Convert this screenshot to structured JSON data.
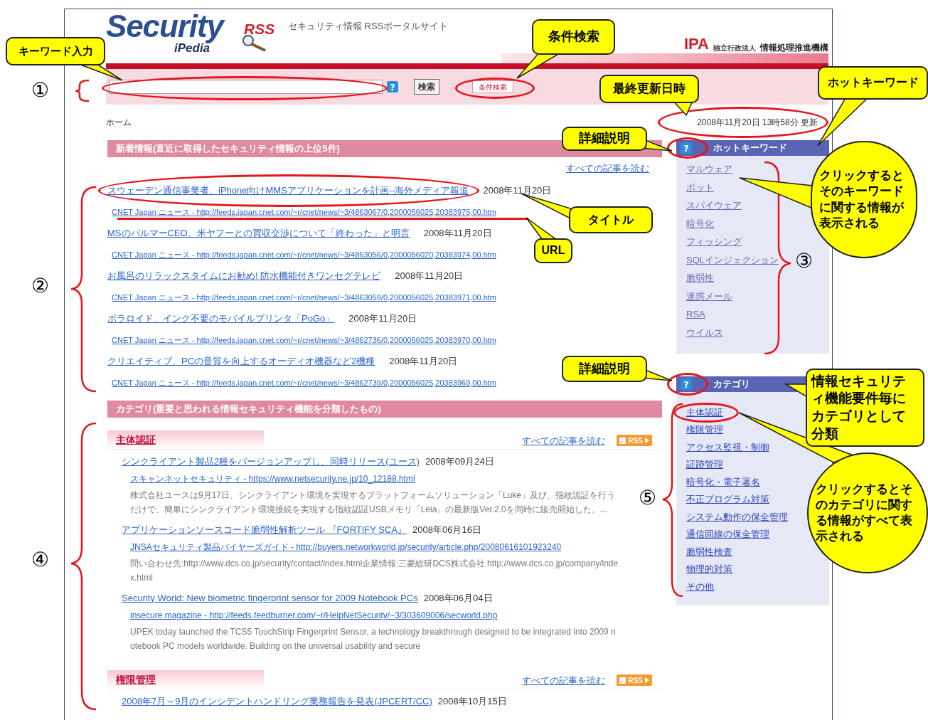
{
  "header": {
    "logo_main": "Security",
    "logo_rss": "RSS",
    "logo_sub": "iPedia",
    "tagline": "セキュリティ情報 RSSポータルサイト",
    "org_logo": "IPA",
    "org_type": "独立行政法人",
    "org_name": "情報処理推進機構"
  },
  "search": {
    "help_icon": "?",
    "search_button": "検索",
    "advanced_button": "条件検索"
  },
  "breadcrumb": "ホーム",
  "updated": "2008年11月20日 13時58分 更新",
  "latest": {
    "heading": "新着情報(直近に取得したセキュリティ情報の上位5件)",
    "read_all": "すべての記事を読む",
    "items": [
      {
        "title": "スウェーデン通信事業者、iPhone向けMMSアプリケーションを計画--海外メディア報道",
        "date": "2008年11月20日",
        "url": "CNET Japan ニュース - http://feeds.japan.cnet.com/~r/cnet/news/~3/4863067/0,2000056025,20383975,00.htm"
      },
      {
        "title": "MSのバルマーCEO、米ヤフーとの買収交渉について「終わった」と明言",
        "date": "2008年11月20日",
        "url": "CNET Japan ニュース - http://feeds.japan.cnet.com/~r/cnet/news/~3/4863056/0,2000056020,20383974,00.htm"
      },
      {
        "title": "お風呂のリラックスタイムにお勧め! 防水機能付きワンセグテレビ",
        "date": "2008年11月20日",
        "url": "CNET Japan ニュース - http://feeds.japan.cnet.com/~r/cnet/news/~3/4863059/0,2000056025,20383971,00.htm"
      },
      {
        "title": "ポラロイド、インク不要のモバイルプリンタ「PoGo」",
        "date": "2008年11月20日",
        "url": "CNET Japan ニュース - http://feeds.japan.cnet.com/~r/cnet/news/~3/4862736/0,2000056025,20383970,00.htm"
      },
      {
        "title": "クリエイティブ、PCの音質を向上するオーディオ機器など2機種",
        "date": "2008年11月20日",
        "url": "CNET Japan ニュース - http://feeds.japan.cnet.com/~r/cnet/news/~3/4862739/0,2000056025,20383969,00.htm"
      }
    ]
  },
  "categories": {
    "heading": "カテゴリ(重要と思われる情報セキュリティ機能を分類したもの)",
    "sections": [
      {
        "name": "主体認証",
        "read_all": "すべての記事を読む",
        "rss": "RSS",
        "items": [
          {
            "title": "シンクライアント製品2種をバージョンアップし、同時リリース(ユース)",
            "date": "2008年09月24日",
            "url": "スキャンネットセキュリティ - https://www.netsecurity.ne.jp/10_12188.html",
            "description": "株式会社ユースは9月17日、シンクライアント環境を実現するプラットフォームソリューション「Luke」及び、指紋認証を行うだけで、簡単にシンクライアント環境接続を実現する指紋認証USBメモリ「Leia」の最新版Ver.2.0を同時に販売開始した。..."
          },
          {
            "title": "アプリケーションソースコード脆弱性解析ツール 『FORTIFY SCA』",
            "date": "2008年06月16日",
            "url": "JNSAセキュリティ製品バイヤーズガイド - http://buyers.networkworld.jp/security/article.php/20080616101923240",
            "description": "問い合わせ先:http://www.dcs.co.jp/security/contact/index.html企業情報:三菱総研DCS株式会社 http://www.dcs.co.jp/company/index.html"
          },
          {
            "title": "Security World: New biometric fingerprint sensor for 2009 Notebook PCs",
            "date": "2008年06月04日",
            "url": "insecure magazine - http://feeds.feedburner.com/~r/HelpNetSecurity/~3/303609006/secworld.php",
            "description": "UPEK today launched the TCS5 TouchStrip Fingerprint Sensor, a technology breakthrough designed to be integrated into 2009 notebook PC models worldwide. Building on the universal usability and secure"
          }
        ]
      },
      {
        "name": "権限管理",
        "read_all": "すべての記事を読む",
        "rss": "RSS",
        "items": [
          {
            "title": "2008年7月～9月のインシデントハンドリング業務報告を発表(JPCERT/CC)",
            "date": "2008年10月15日"
          }
        ]
      }
    ]
  },
  "sidebar": {
    "hot_keywords": {
      "icon": "?",
      "heading": "ホットキーワード",
      "items": [
        "マルウェア",
        "ボット",
        "スパイウェア",
        "暗号化",
        "フィッシング",
        "SQLインジェクション",
        "脆弱性",
        "迷惑メール",
        "RSA",
        "ウイルス"
      ]
    },
    "categories": {
      "icon": "?",
      "heading": "カテゴリ",
      "items": [
        "主体認証",
        "権限管理",
        "アクセス監視・制御",
        "証跡管理",
        "暗号化・電子署名",
        "不正プログラム対策",
        "システム動作の保全管理",
        "通信回線の保全管理",
        "脆弱性検査",
        "物理的対策",
        "その他"
      ]
    }
  },
  "annotations": {
    "callouts": [
      {
        "kind": "box",
        "text": "キーワード入力"
      },
      {
        "kind": "box",
        "text": "条件検索"
      },
      {
        "kind": "box",
        "text": "最終更新日時"
      },
      {
        "kind": "box",
        "text": "ホットキーワード"
      },
      {
        "kind": "box",
        "text": "詳細説明"
      },
      {
        "kind": "box",
        "text": "タイトル"
      },
      {
        "kind": "box",
        "text": "URL"
      },
      {
        "kind": "circle",
        "text": "クリックするとそのキーワードに関する情報が表示される"
      },
      {
        "kind": "box",
        "text": "詳細説明"
      },
      {
        "kind": "box",
        "text": "情報セキュリティ機能要件毎にカテゴリとして分類"
      },
      {
        "kind": "circle",
        "text": "クリックするとそのカテゴリに関する情報がすべて表示される"
      }
    ],
    "markers": [
      "①",
      "②",
      "③",
      "④",
      "⑤"
    ]
  }
}
